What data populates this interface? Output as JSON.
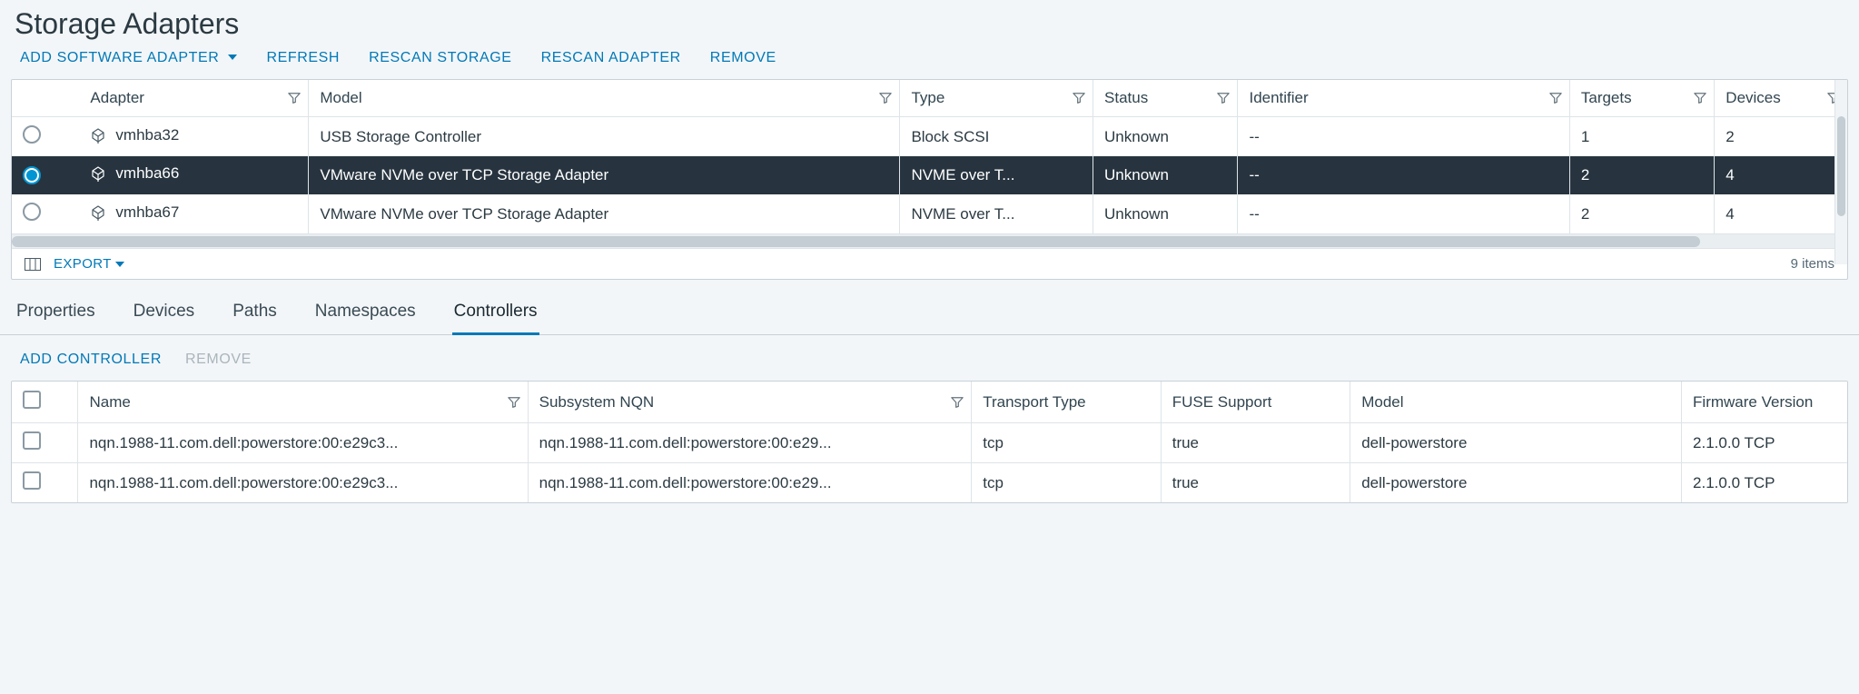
{
  "title": "Storage Adapters",
  "toolbar": {
    "add_software_adapter": "ADD SOFTWARE ADAPTER",
    "refresh": "REFRESH",
    "rescan_storage": "RESCAN STORAGE",
    "rescan_adapter": "RESCAN ADAPTER",
    "remove": "REMOVE"
  },
  "adapters": {
    "columns": {
      "adapter": "Adapter",
      "model": "Model",
      "type": "Type",
      "status": "Status",
      "identifier": "Identifier",
      "targets": "Targets",
      "devices": "Devices"
    },
    "rows": [
      {
        "adapter": "vmhba32",
        "model": "USB Storage Controller",
        "type": "Block SCSI",
        "status": "Unknown",
        "identifier": "--",
        "targets": "1",
        "devices": "2",
        "selected": false
      },
      {
        "adapter": "vmhba66",
        "model": "VMware NVMe over TCP Storage Adapter",
        "type": "NVME over T...",
        "status": "Unknown",
        "identifier": "--",
        "targets": "2",
        "devices": "4",
        "selected": true
      },
      {
        "adapter": "vmhba67",
        "model": "VMware NVMe over TCP Storage Adapter",
        "type": "NVME over T...",
        "status": "Unknown",
        "identifier": "--",
        "targets": "2",
        "devices": "4",
        "selected": false
      }
    ],
    "footer": {
      "export": "EXPORT",
      "item_count": "9 items"
    }
  },
  "tabs": [
    {
      "label": "Properties",
      "active": false
    },
    {
      "label": "Devices",
      "active": false
    },
    {
      "label": "Paths",
      "active": false
    },
    {
      "label": "Namespaces",
      "active": false
    },
    {
      "label": "Controllers",
      "active": true
    }
  ],
  "controllers_toolbar": {
    "add_controller": "ADD CONTROLLER",
    "remove": "REMOVE"
  },
  "controllers": {
    "columns": {
      "name": "Name",
      "subsystem_nqn": "Subsystem NQN",
      "transport_type": "Transport Type",
      "fuse_support": "FUSE Support",
      "model": "Model",
      "firmware_version": "Firmware Version"
    },
    "rows": [
      {
        "name": "nqn.1988-11.com.dell:powerstore:00:e29c3...",
        "subsystem_nqn": "nqn.1988-11.com.dell:powerstore:00:e29...",
        "transport_type": "tcp",
        "fuse_support": "true",
        "model": "dell-powerstore",
        "firmware_version": "2.1.0.0 TCP"
      },
      {
        "name": "nqn.1988-11.com.dell:powerstore:00:e29c3...",
        "subsystem_nqn": "nqn.1988-11.com.dell:powerstore:00:e29...",
        "transport_type": "tcp",
        "fuse_support": "true",
        "model": "dell-powerstore",
        "firmware_version": "2.1.0.0 TCP"
      }
    ]
  }
}
